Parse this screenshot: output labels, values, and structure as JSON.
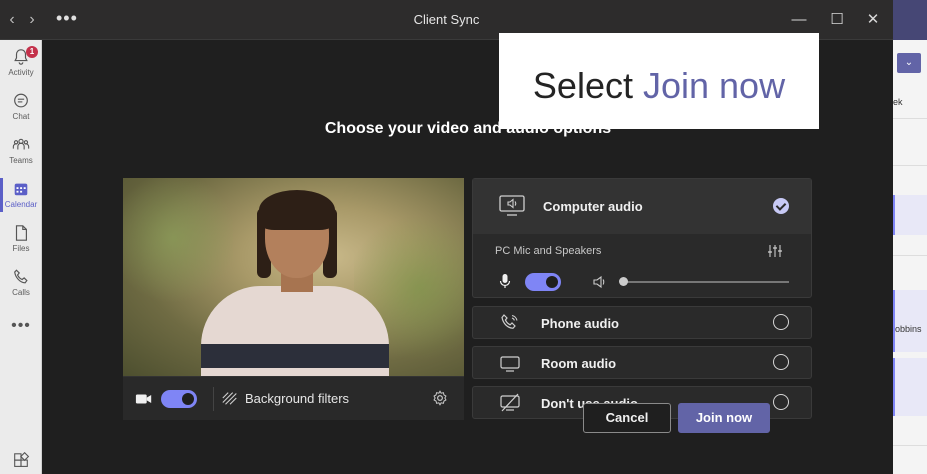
{
  "window": {
    "title": "Client Sync",
    "more_label": "•••",
    "back_glyph": "‹",
    "forward_glyph": "›",
    "minimize_glyph": "—",
    "maximize_glyph": "☐",
    "close_glyph": "✕"
  },
  "rail": {
    "items": [
      {
        "label": "Activity",
        "icon": "bell-icon",
        "badge": "1"
      },
      {
        "label": "Chat",
        "icon": "chat-icon"
      },
      {
        "label": "Teams",
        "icon": "teams-icon"
      },
      {
        "label": "Calendar",
        "icon": "calendar-icon"
      },
      {
        "label": "Files",
        "icon": "file-icon"
      },
      {
        "label": "Calls",
        "icon": "phone-icon"
      }
    ],
    "more_label": "•••",
    "active": "Calendar"
  },
  "heading": "Choose your video and audio options",
  "video": {
    "camera_on": true,
    "background_filters_label": "Background filters"
  },
  "audio": {
    "options": [
      {
        "label": "Computer audio",
        "icon": "monitor-speaker-icon",
        "selected": true
      },
      {
        "label": "Phone audio",
        "icon": "phone-audio-icon",
        "selected": false
      },
      {
        "label": "Room audio",
        "icon": "room-display-icon",
        "selected": false
      },
      {
        "label": "Don't use audio",
        "icon": "no-audio-icon",
        "selected": false
      }
    ],
    "device_label": "PC Mic and Speakers",
    "mic_on": true,
    "volume": 0.0
  },
  "buttons": {
    "cancel_label": "Cancel",
    "join_label": "Join now"
  },
  "right_peek": {
    "dropdown_glyph": "⌄",
    "week_text": "ek",
    "name_text": "obbins"
  },
  "callout": {
    "prefix": "Select ",
    "accent": "Join now"
  },
  "colors": {
    "accent": "#6264a7",
    "toggle": "#7f85f5",
    "badge": "#c4314b"
  }
}
